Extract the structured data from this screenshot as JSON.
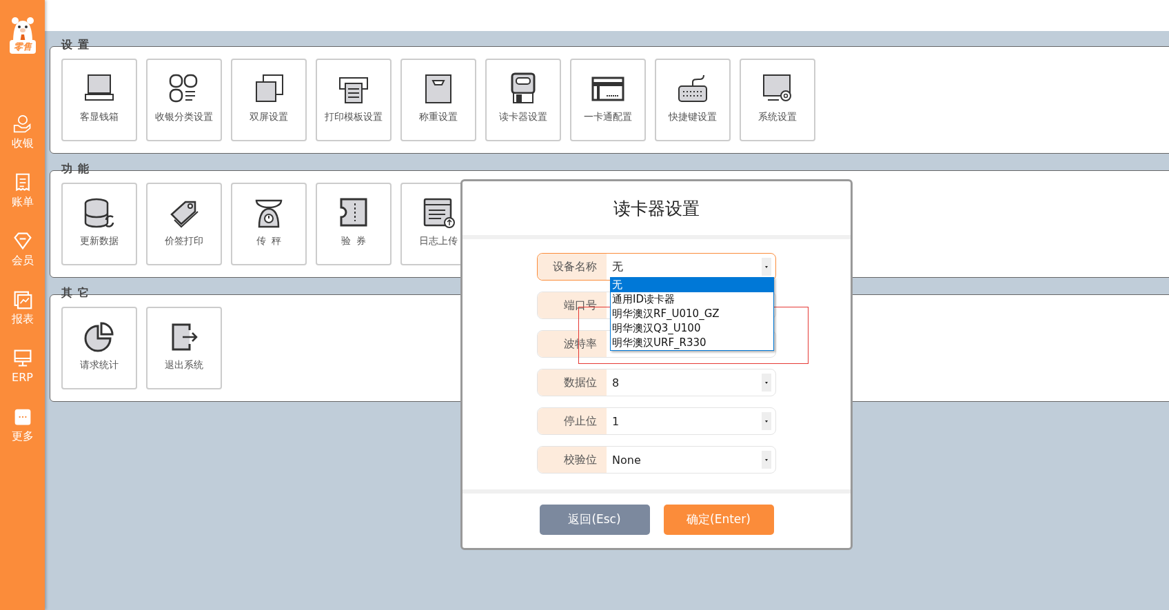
{
  "sidebar": {
    "logo": "零售",
    "items": [
      {
        "label": "收银"
      },
      {
        "label": "账单"
      },
      {
        "label": "会员"
      },
      {
        "label": "报表"
      },
      {
        "label": "ERP"
      },
      {
        "label": "更多"
      }
    ]
  },
  "sections": [
    {
      "title": "设 置",
      "tiles": [
        {
          "label": "客显钱箱"
        },
        {
          "label": "收银分类设置"
        },
        {
          "label": "双屏设置"
        },
        {
          "label": "打印模板设置"
        },
        {
          "label": "称重设置"
        },
        {
          "label": "读卡器设置"
        },
        {
          "label": "一卡通配置"
        },
        {
          "label": "快捷键设置"
        },
        {
          "label": "系统设置"
        }
      ]
    },
    {
      "title": "功 能",
      "tiles": [
        {
          "label": "更新数据"
        },
        {
          "label": "价签打印"
        },
        {
          "label": "传  秤"
        },
        {
          "label": "验  券"
        },
        {
          "label": "日志上传"
        }
      ]
    },
    {
      "title": "其 它",
      "tiles": [
        {
          "label": "请求统计"
        },
        {
          "label": "退出系统"
        }
      ]
    }
  ],
  "dialog": {
    "title": "读卡器设置",
    "fields": [
      {
        "label": "设备名称",
        "value": "无",
        "focused": true
      },
      {
        "label": "端口号",
        "focused": false
      },
      {
        "label": "波特率",
        "focused": false
      },
      {
        "label": "数据位",
        "value": "8",
        "focused": false
      },
      {
        "label": "停止位",
        "value": "1",
        "focused": false
      },
      {
        "label": "校验位",
        "value": "None",
        "focused": false
      }
    ],
    "dropdown": {
      "options": [
        {
          "label": "无",
          "selected": true
        },
        {
          "label": "通用ID读卡器",
          "selected": false
        },
        {
          "label": "明华澳汉RF_U010_GZ",
          "selected": false
        },
        {
          "label": "明华澳汉Q3_U100",
          "selected": false
        },
        {
          "label": "明华澳汉URF_R330",
          "selected": false
        }
      ]
    },
    "buttons": [
      {
        "label": "返回(Esc)",
        "kind": "secondary"
      },
      {
        "label": "确定(Enter)",
        "kind": "primary"
      }
    ]
  }
}
